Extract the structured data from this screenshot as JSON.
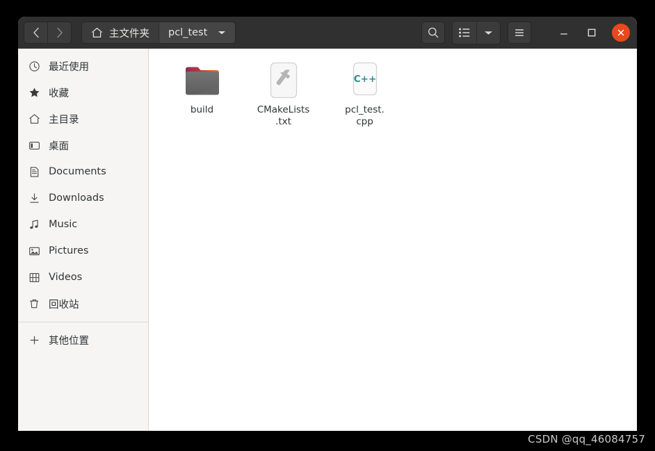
{
  "window": {
    "title": "pcl_test",
    "accent_close_color": "#e8491f",
    "header_bg": "#303030",
    "sidebar_bg": "#f6f5f4",
    "content_bg": "#ffffff"
  },
  "header": {
    "nav": {
      "back_label": "‹",
      "forward_label": "›"
    },
    "breadcrumbs": [
      {
        "label": "主文件夹",
        "icon": "home-icon",
        "current": false
      },
      {
        "label": "pcl_test",
        "icon": "",
        "current": true
      }
    ],
    "buttons": {
      "search": "search-icon",
      "list_view": "list-view-icon",
      "view_dropdown": "chevron-down-icon",
      "menu": "hamburger-menu-icon",
      "minimize": "minimize-icon",
      "maximize": "maximize-icon",
      "close": "close-icon"
    }
  },
  "sidebar": {
    "items": [
      {
        "label": "最近使用",
        "icon": "clock-icon"
      },
      {
        "label": "收藏",
        "icon": "star-icon"
      },
      {
        "label": "主目录",
        "icon": "home-icon"
      },
      {
        "label": "桌面",
        "icon": "desktop-icon"
      },
      {
        "label": "Documents",
        "icon": "document-icon"
      },
      {
        "label": "Downloads",
        "icon": "download-icon"
      },
      {
        "label": "Music",
        "icon": "music-note-icon"
      },
      {
        "label": "Pictures",
        "icon": "picture-icon"
      },
      {
        "label": "Videos",
        "icon": "video-film-icon"
      },
      {
        "label": "回收站",
        "icon": "trash-icon"
      }
    ],
    "other_locations": {
      "label": "其他位置",
      "icon": "plus-icon"
    }
  },
  "content": {
    "files": [
      {
        "name": "build",
        "line1": "build",
        "line2": "",
        "icon": "folder-icon",
        "type": "folder"
      },
      {
        "name": "CMakeLists.txt",
        "line1": "CMakeLists",
        "line2": ".txt",
        "icon": "hammer-file-icon",
        "type": "file"
      },
      {
        "name": "pcl_test.cpp",
        "line1": "pcl_test.",
        "line2": "cpp",
        "icon": "cpp-file-icon",
        "type": "file",
        "badge": "C++"
      }
    ]
  },
  "watermark": {
    "text": "CSDN @qq_46084757"
  }
}
